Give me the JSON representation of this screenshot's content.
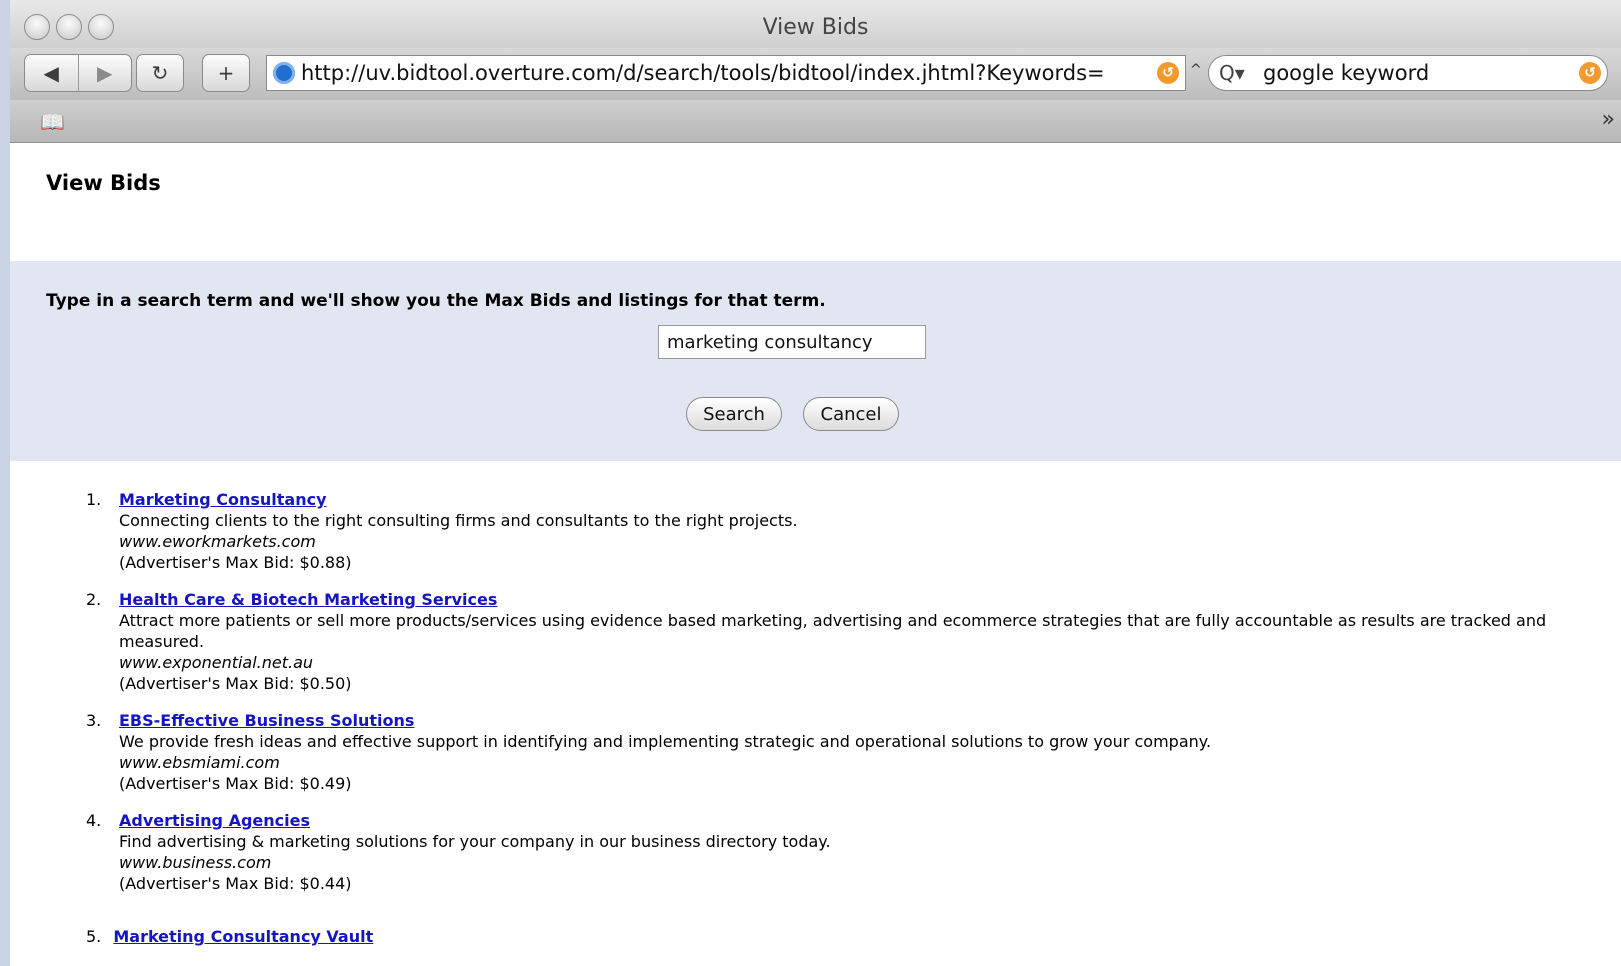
{
  "window": {
    "title": "View Bids"
  },
  "toolbar": {
    "back_glyph": "◀",
    "forward_glyph": "▶",
    "reload_glyph": "↻",
    "add_glyph": "+",
    "address": "http://uv.bidtool.overture.com/d/search/tools/bidtool/index.jhtml?Keywords=",
    "search_value": "google keyword",
    "search_glyph": "Q▾",
    "snapback_glyph": "↺"
  },
  "bookmarks": {
    "book_glyph": "📖",
    "more_glyph": "»"
  },
  "page": {
    "title": "View Bids",
    "prompt": "Type in a search term and we'll show you the Max Bids and listings for that term.",
    "keyword_value": "marketing consultancy",
    "search_button": "Search",
    "cancel_button": "Cancel"
  },
  "results": [
    {
      "num": "1.",
      "title": "Marketing Consultancy",
      "desc": "Connecting clients to the right consulting firms and consultants to the right projects.",
      "url": "www.eworkmarkets.com",
      "bid": "(Advertiser's Max Bid: $0.88)"
    },
    {
      "num": "2.",
      "title": "Health Care & Biotech Marketing Services",
      "desc": "Attract more patients or sell more products/services using evidence based marketing, advertising and ecommerce strategies that are fully accountable as results are tracked and measured.",
      "url": "www.exponential.net.au",
      "bid": "(Advertiser's Max Bid: $0.50)"
    },
    {
      "num": "3.",
      "title": "EBS-Effective Business Solutions",
      "desc": "We provide fresh ideas and effective support in identifying and implementing strategic and operational solutions to grow your company.",
      "url": "www.ebsmiami.com",
      "bid": "(Advertiser's Max Bid: $0.49)"
    },
    {
      "num": "4.",
      "title": "Advertising Agencies",
      "desc": "Find advertising & marketing solutions for your company in our business directory today.",
      "url": "www.business.com",
      "bid": "(Advertiser's Max Bid: $0.44)"
    }
  ],
  "partial_result": {
    "num": "5.",
    "title": "Marketing Consultancy Vault"
  }
}
